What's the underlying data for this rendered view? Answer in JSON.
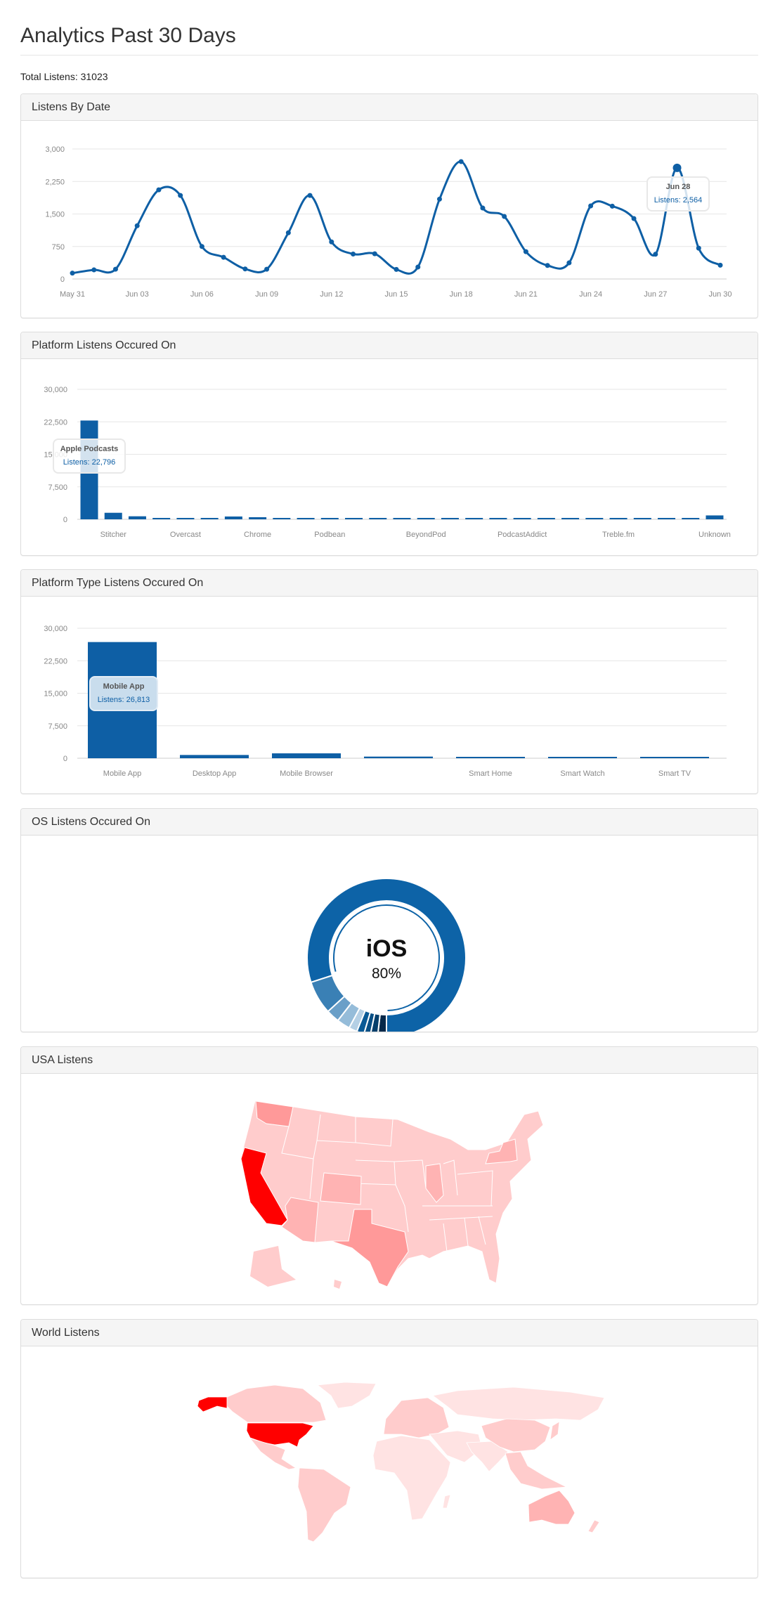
{
  "page": {
    "title": "Analytics Past 30 Days",
    "total_label": "Total Listens:",
    "total_value": "31023"
  },
  "panels": {
    "by_date": "Listens By Date",
    "platform": "Platform Listens Occured On",
    "platform_type": "Platform Type Listens Occured On",
    "os": "OS Listens Occured On",
    "usa": "USA Listens",
    "world": "World Listens"
  },
  "tooltips": {
    "by_date": {
      "title": "Jun 28",
      "value": "Listens: 2,564"
    },
    "platform": {
      "title": "Apple Podcasts",
      "value": "Listens: 22,796"
    },
    "platform_type": {
      "title": "Mobile App",
      "value": "Listens: 26,813"
    }
  },
  "colors": {
    "series": "#0e5fa5",
    "grid": "#e6e6e6",
    "axis_text": "#888888"
  },
  "chart_data": [
    {
      "type": "line",
      "ylim": [
        0,
        3000
      ],
      "yticks": [
        0,
        750,
        1500,
        2250,
        3000
      ],
      "grid": true,
      "x": [
        "May 31",
        "Jun 01",
        "Jun 02",
        "Jun 03",
        "Jun 04",
        "Jun 05",
        "Jun 06",
        "Jun 07",
        "Jun 08",
        "Jun 09",
        "Jun 10",
        "Jun 11",
        "Jun 12",
        "Jun 13",
        "Jun 14",
        "Jun 15",
        "Jun 16",
        "Jun 17",
        "Jun 18",
        "Jun 19",
        "Jun 20",
        "Jun 21",
        "Jun 22",
        "Jun 23",
        "Jun 24",
        "Jun 25",
        "Jun 26",
        "Jun 27",
        "Jun 28",
        "Jun 29",
        "Jun 30"
      ],
      "xticks": [
        "May 31",
        "Jun 03",
        "Jun 06",
        "Jun 09",
        "Jun 12",
        "Jun 15",
        "Jun 18",
        "Jun 21",
        "Jun 24",
        "Jun 27",
        "Jun 30"
      ],
      "values": [
        135,
        210,
        226,
        1228,
        2057,
        1928,
        749,
        501,
        232,
        226,
        1066,
        1928,
        856,
        576,
        582,
        221,
        275,
        1842,
        2709,
        1637,
        1443,
        630,
        312,
        372,
        1686,
        1680,
        1395,
        571,
        2564,
        711,
        318
      ],
      "highlight": "Jun 28"
    },
    {
      "type": "bar",
      "ylim": [
        0,
        30000
      ],
      "yticks": [
        0,
        7500,
        15000,
        22500,
        30000
      ],
      "grid": true,
      "categories": [
        "",
        "Stitcher",
        "",
        "",
        "Overcast",
        "",
        "",
        "Chrome",
        "",
        "",
        "Podbean",
        "",
        "",
        "",
        "BeyondPod",
        "",
        "",
        "",
        "PodcastAddict",
        "",
        "",
        "",
        "Treble.fm",
        "",
        "",
        "",
        "Unknown"
      ],
      "values": [
        22796,
        1508,
        700,
        215,
        215,
        320,
        650,
        485,
        50,
        60,
        215,
        40,
        40,
        30,
        30,
        30,
        215,
        15,
        50,
        40,
        30,
        40,
        10,
        5,
        5,
        5,
        900
      ]
    },
    {
      "type": "bar",
      "ylim": [
        0,
        30000
      ],
      "yticks": [
        0,
        7500,
        15000,
        22500,
        30000
      ],
      "grid": true,
      "categories": [
        "Mobile App",
        "Desktop App",
        "Mobile Browser",
        "",
        "Smart Home",
        "Smart Watch",
        "Smart TV"
      ],
      "values": [
        26813,
        755,
        1130,
        380,
        5,
        30,
        5
      ]
    },
    {
      "type": "pie",
      "donut": true,
      "center_label": "iOS",
      "center_value": "80%",
      "values": [
        80,
        1.8,
        1.5,
        1.3,
        1.5,
        1.7,
        2.7,
        2.7,
        6.8
      ],
      "colors": [
        "#0d63a7",
        "#06294a",
        "#063f6b",
        "#084f85",
        "#0a5a96",
        "#b5d0e5",
        "#95bcd9",
        "#6a9fc8",
        "#3a80b5"
      ]
    }
  ],
  "maps": {
    "usa": {
      "base": "#ffcccc",
      "california": "#ff0000",
      "texas": "#ff9999",
      "washington": "#ff9999",
      "new_york": "#ffb3b3",
      "illinois": "#ffb3b3",
      "colorado": "#ffb3b3",
      "arizona": "#ffb3b3"
    },
    "world": {
      "usa": "#ff0000",
      "canada": "#ffcccc",
      "latam": "#ffcccc",
      "greenland": "#ffe3e3",
      "europe": "#ffcccc",
      "africa": "#ffe3e3",
      "russia": "#ffe3e3",
      "india": "#ffe3e3",
      "china": "#ffcccc",
      "se_asia": "#ffcccc",
      "australia": "#ffb3b3"
    }
  }
}
